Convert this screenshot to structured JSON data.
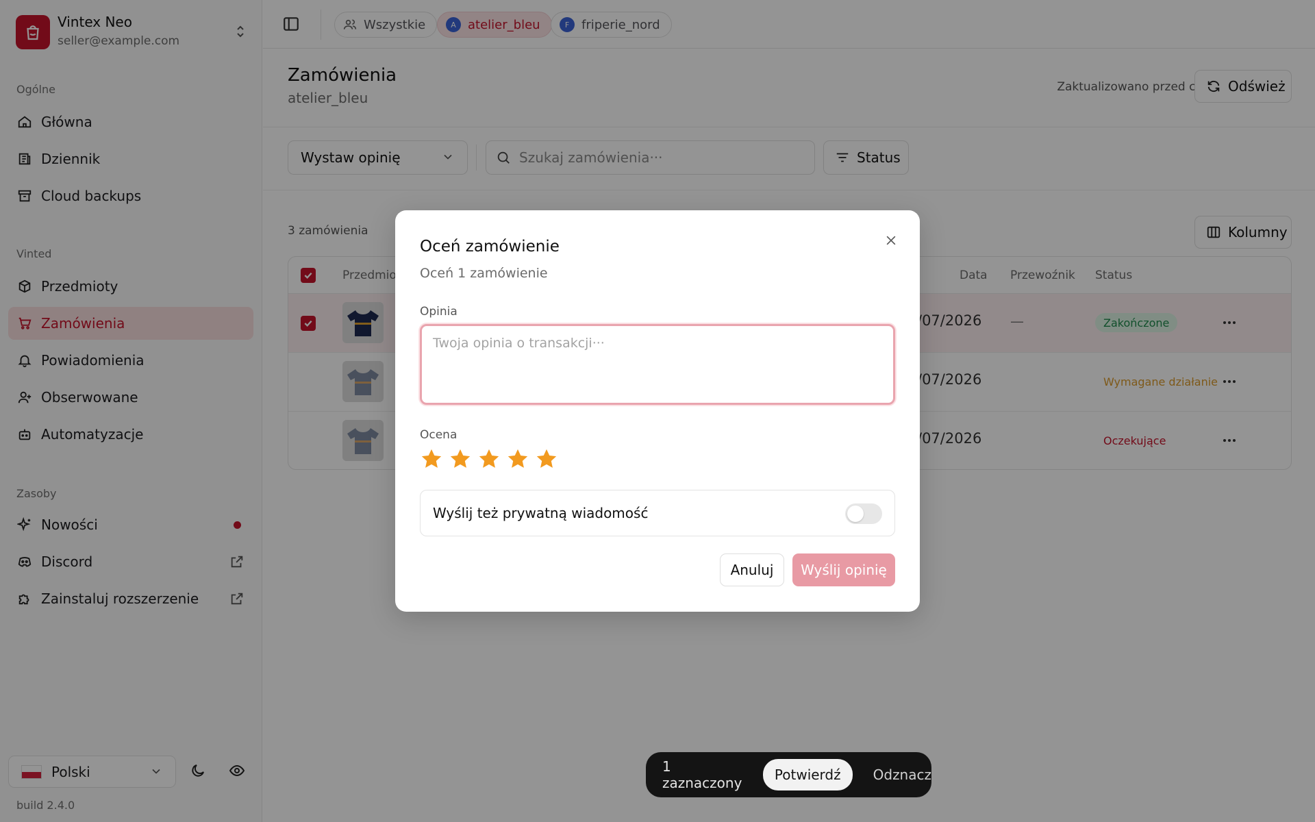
{
  "account": {
    "name": "Vintex Neo",
    "email": "seller@example.com"
  },
  "sidebar": {
    "sections": [
      {
        "label": "Ogólne"
      },
      {
        "label": "Vinted"
      },
      {
        "label": "Zasoby"
      }
    ],
    "items": [
      {
        "label": "Główna",
        "icon": "home-icon"
      },
      {
        "label": "Dziennik",
        "icon": "journal-icon"
      },
      {
        "label": "Cloud backups",
        "icon": "archive-icon"
      },
      {
        "label": "Przedmioty",
        "icon": "package-icon"
      },
      {
        "label": "Zamówienia",
        "icon": "cart-icon",
        "active": true
      },
      {
        "label": "Powiadomienia",
        "icon": "bell-icon"
      },
      {
        "label": "Obserwowane",
        "icon": "user-plus-icon"
      },
      {
        "label": "Automatyzacje",
        "icon": "bot-icon"
      },
      {
        "label": "Nowości",
        "icon": "sparkles-icon",
        "badge": "dot"
      },
      {
        "label": "Discord",
        "icon": "discord-icon",
        "external": true
      },
      {
        "label": "Zainstaluj rozszerzenie",
        "icon": "puzzle-icon",
        "external": true
      }
    ],
    "language": "Polski",
    "build": "build 2.4.0"
  },
  "topbar": {
    "chips": [
      {
        "label": "Wszystkie",
        "icon": "users-icon"
      },
      {
        "label": "atelier_bleu",
        "avatar": "A",
        "active": true
      },
      {
        "label": "friperie_nord",
        "avatar": "F"
      }
    ]
  },
  "page": {
    "title": "Zamówienia",
    "subtitle": "atelier_bleu",
    "updated": "Zaktualizowano przed chwilą",
    "refresh_label": "Odśwież",
    "action_select": "Wystaw opinię",
    "search_placeholder": "Szukaj zamówienia···",
    "status_filter": "Status",
    "count": "3 zamówienia",
    "columns_label": "Kolumny"
  },
  "table": {
    "headers": {
      "item": "Przedmiot",
      "date": "Data",
      "carrier": "Przewoźnik",
      "status": "Status"
    },
    "rows": [
      {
        "date": "/07/2026",
        "carrier": "—",
        "status": "Zakończone",
        "status_color": "#1f8a4c",
        "status_bg": "#dcf3e4",
        "selected": true,
        "thumb_color": "#1e2a52"
      },
      {
        "date": "/07/2026",
        "carrier": "",
        "status": "Wymagane działanie",
        "status_color": "#d99a2b",
        "status_bg": "transparent",
        "selected": false,
        "thumb_color": "#7f8aa0"
      },
      {
        "date": "/07/2026",
        "carrier": "",
        "status": "Oczekujące",
        "status_color": "#c4142c",
        "status_bg": "transparent",
        "selected": false,
        "thumb_color": "#7f8aa0"
      }
    ]
  },
  "modal": {
    "title": "Oceń zamówienie",
    "subtitle": "Oceń 1 zamówienie",
    "opinion_label": "Opinia",
    "opinion_placeholder": "Twoja opinia o transakcji···",
    "opinion_value": "",
    "rating_label": "Ocena",
    "rating": 5,
    "rating_max": 5,
    "private_message_label": "Wyślij też prywatną wiadomość",
    "private_message_on": false,
    "cancel_label": "Anuluj",
    "submit_label": "Wyślij opinię"
  },
  "selection_bar": {
    "count_label": "1 zaznaczony",
    "confirm_label": "Potwierdź",
    "deselect_label": "Odznacz"
  },
  "colors": {
    "accent": "#c4142c",
    "star": "#f29a1f"
  }
}
